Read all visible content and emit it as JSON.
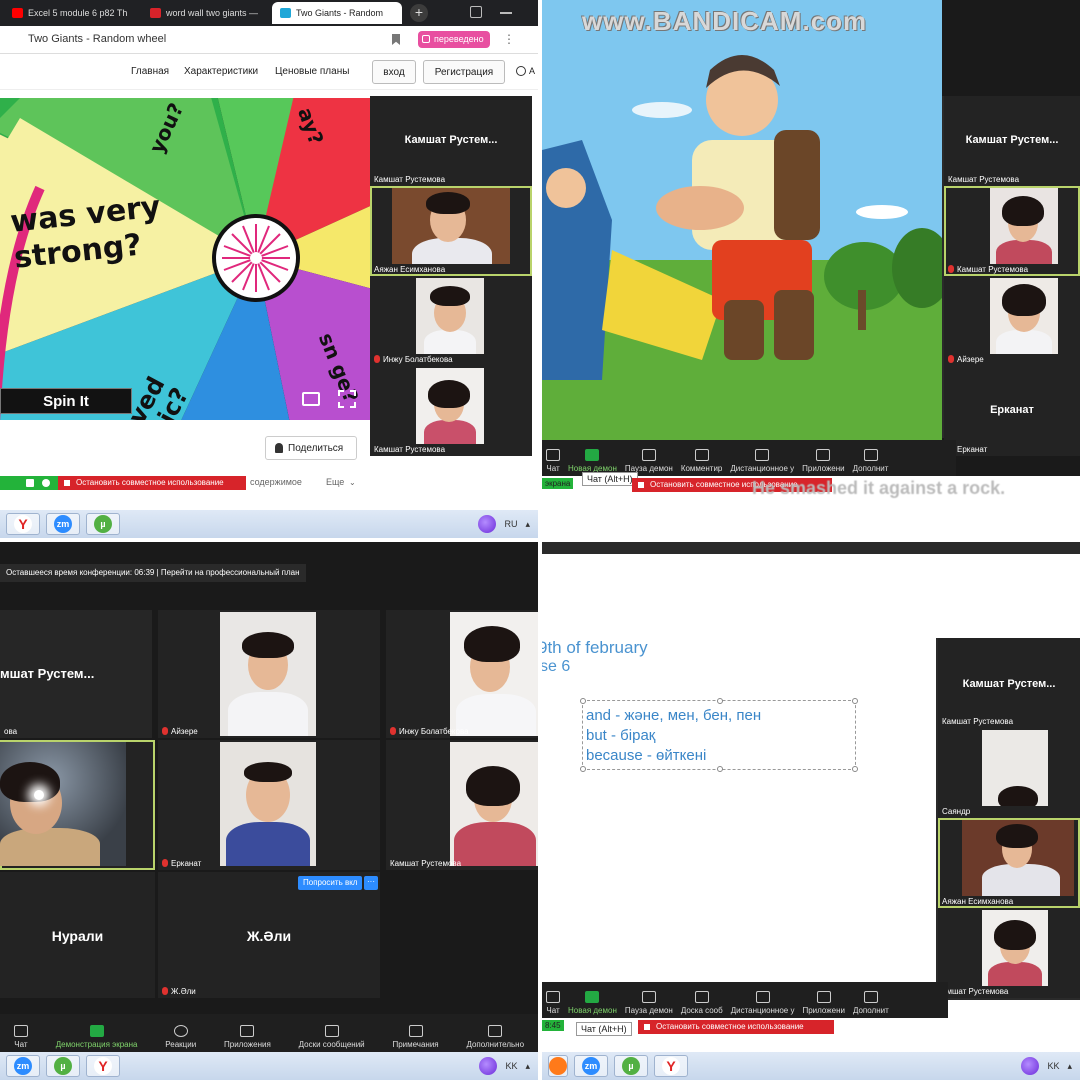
{
  "q1": {
    "tabs": [
      {
        "label": "Excel 5 module 6 p82 Th",
        "color": "#ff0000"
      },
      {
        "label": "word wall two giants —",
        "color": "#d8232a"
      },
      {
        "label": "Two Giants - Random",
        "color": "#1fa7d8"
      }
    ],
    "page_title": "Two Giants - Random wheel",
    "translated_badge": "переведено",
    "nav": {
      "home": "Главная",
      "features": "Характеристики",
      "pricing": "Ценовые планы",
      "login": "вход",
      "register": "Регистрация",
      "lang_short": "А"
    },
    "wheel": {
      "seg_text_main": "was very strong?",
      "seg_text_tl": "you?",
      "seg_text_tr": "ay?",
      "seg_text_bl": "ved sic?",
      "seg_text_br": "sn ge?",
      "spin_label": "Spin It"
    },
    "share_label": "Поделиться",
    "stop_share": "Остановить совместное использование",
    "content_label": "содержимое",
    "more_label": "Еще",
    "participants": [
      {
        "big": "Камшат  Рустем...",
        "name": "Камшат Рустемова"
      },
      {
        "name": "Аяжан Есимханова"
      },
      {
        "name": "Инжу Болатбекова"
      },
      {
        "name": "Камшат Рустемова"
      }
    ],
    "taskbar_lang": "RU",
    "taskbar_zm": "zm"
  },
  "q2": {
    "watermark": "www.BANDICAM.com",
    "caption": "He smashed it against a rock.",
    "participants": [
      {
        "big": "Камшат  Рустем...",
        "name": "Камшат Рустемова"
      },
      {
        "name": "Камшат Рустемова"
      },
      {
        "name": "Айзере"
      },
      {
        "big": "Ерканат",
        "name": "Ерканат"
      }
    ],
    "toolbar": [
      "Чат",
      "Новая демон",
      "Пауза демон",
      "Комментир",
      "Дистанционное у",
      "Приложени",
      "Дополнит"
    ],
    "screen_label": "экрана",
    "chat_tip": "Чат (Alt+H)",
    "stop_share": "Остановить совместное использование"
  },
  "q3": {
    "banner": "Оставшееся время конференции: 06:39 | Перейти на профессиональный план",
    "tiles": [
      {
        "big": "мшат  Рустем...",
        "name": "ова"
      },
      {
        "name": "Айзере"
      },
      {
        "name": "Инжу Болатбекова"
      },
      {
        "name": ""
      },
      {
        "name": "Ерканат"
      },
      {
        "name": "Камшат Рустемова"
      },
      {
        "big": "Нурали",
        "name": ""
      },
      {
        "big": "Ж.Әли",
        "name": "Ж.Әли"
      }
    ],
    "ask_button": "Попросить вкл",
    "toolbar": [
      "Чат",
      "Демонстрация экрана",
      "Реакции",
      "Приложения",
      "Доски сообщений",
      "Примечания",
      "Дополнительно"
    ],
    "taskbar_lang": "KK",
    "taskbar_zm": "zm"
  },
  "q4": {
    "date": "9th of february",
    "exercise": "se 6",
    "lines": [
      "and - және, мен, бен, пен",
      "but - бірақ",
      "because - өйткені"
    ],
    "participants": [
      {
        "big": "Камшат  Рустем...",
        "name": "Камшат Рустемова"
      },
      {
        "name": "Саяндр"
      },
      {
        "name": "Аяжан Есимханова"
      },
      {
        "name": "амшат Рустемова"
      }
    ],
    "toolbar": [
      "Чат",
      "Новая демон",
      "Пауза демон",
      "Доска сооб",
      "Дистанционное у",
      "Приложени",
      "Дополнит"
    ],
    "time": "8:45",
    "chat_tip": "Чат (Alt+H)",
    "stop_share": "Остановить совместное использование",
    "taskbar_lang": "KK",
    "taskbar_zm": "zm"
  }
}
